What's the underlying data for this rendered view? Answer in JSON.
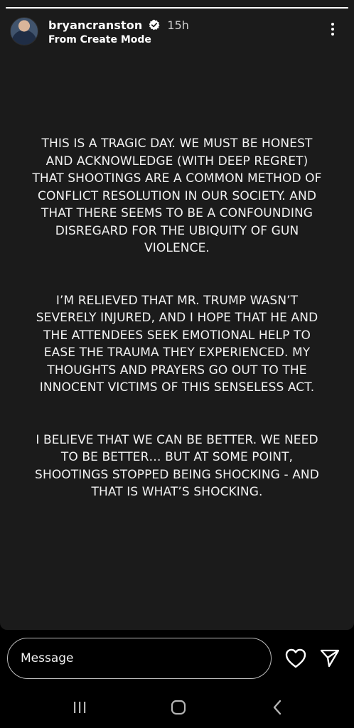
{
  "story": {
    "progress": 1.0,
    "username": "bryancranston",
    "time_ago": "15h",
    "subtitle": "From Create Mode",
    "paragraphs": [
      "THIS IS A TRAGIC DAY. WE MUST BE HONEST\nAND ACKNOWLEDGE (WITH DEEP REGRET)\nTHAT SHOOTINGS ARE A COMMON METHOD OF\nCONFLICT RESOLUTION IN OUR SOCIETY. AND\nTHAT THERE SEEMS TO BE A CONFOUNDING\nDISREGARD FOR THE UBIQUITY OF GUN\nVIOLENCE.",
      "I’M RELIEVED THAT MR. TRUMP WASN’T\nSEVERELY INJURED, AND I HOPE THAT HE AND\nTHE ATTENDEES SEEK EMOTIONAL HELP TO\nEASE THE TRAUMA THEY EXPERIENCED. MY\nTHOUGHTS AND PRAYERS GO OUT TO THE\nINNOCENT VICTIMS OF THIS SENSELESS ACT.",
      "I BELIEVE THAT WE CAN BE BETTER. WE NEED\nTO BE BETTER… BUT AT SOME POINT,\nSHOOTINGS STOPPED BEING SHOCKING - AND\nTHAT IS WHAT’S SHOCKING."
    ],
    "background_color": "#1b1b1b"
  },
  "reply": {
    "placeholder": "Message"
  },
  "icons": {
    "avatar": "profile-photo",
    "verified": "verified-badge-icon",
    "more": "more-vertical-icon",
    "like": "heart-icon",
    "share": "send-icon",
    "nav_recents": "recents-icon",
    "nav_home": "home-icon",
    "nav_back": "back-icon"
  }
}
